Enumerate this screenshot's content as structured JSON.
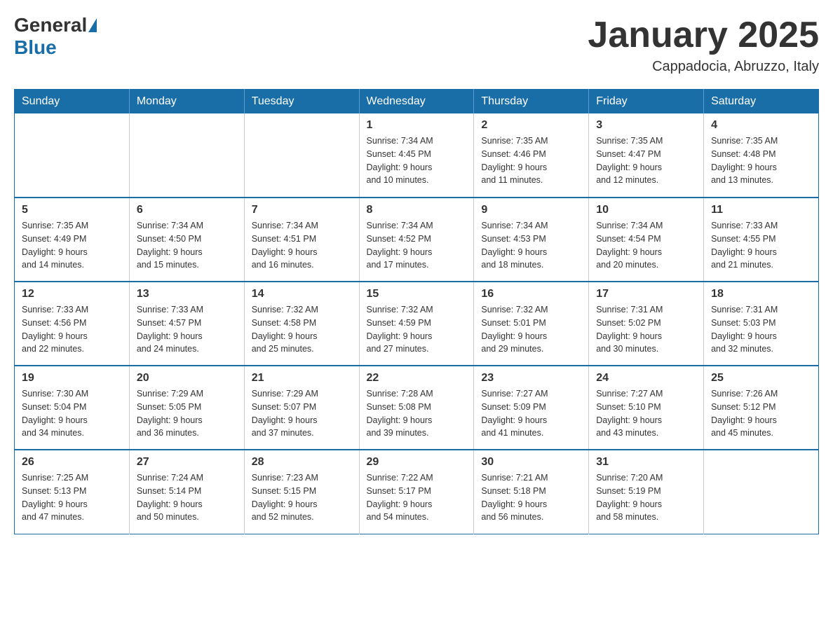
{
  "header": {
    "logo_general": "General",
    "logo_blue": "Blue",
    "title": "January 2025",
    "location": "Cappadocia, Abruzzo, Italy"
  },
  "days_of_week": [
    "Sunday",
    "Monday",
    "Tuesday",
    "Wednesday",
    "Thursday",
    "Friday",
    "Saturday"
  ],
  "weeks": [
    [
      {
        "day": "",
        "info": ""
      },
      {
        "day": "",
        "info": ""
      },
      {
        "day": "",
        "info": ""
      },
      {
        "day": "1",
        "info": "Sunrise: 7:34 AM\nSunset: 4:45 PM\nDaylight: 9 hours\nand 10 minutes."
      },
      {
        "day": "2",
        "info": "Sunrise: 7:35 AM\nSunset: 4:46 PM\nDaylight: 9 hours\nand 11 minutes."
      },
      {
        "day": "3",
        "info": "Sunrise: 7:35 AM\nSunset: 4:47 PM\nDaylight: 9 hours\nand 12 minutes."
      },
      {
        "day": "4",
        "info": "Sunrise: 7:35 AM\nSunset: 4:48 PM\nDaylight: 9 hours\nand 13 minutes."
      }
    ],
    [
      {
        "day": "5",
        "info": "Sunrise: 7:35 AM\nSunset: 4:49 PM\nDaylight: 9 hours\nand 14 minutes."
      },
      {
        "day": "6",
        "info": "Sunrise: 7:34 AM\nSunset: 4:50 PM\nDaylight: 9 hours\nand 15 minutes."
      },
      {
        "day": "7",
        "info": "Sunrise: 7:34 AM\nSunset: 4:51 PM\nDaylight: 9 hours\nand 16 minutes."
      },
      {
        "day": "8",
        "info": "Sunrise: 7:34 AM\nSunset: 4:52 PM\nDaylight: 9 hours\nand 17 minutes."
      },
      {
        "day": "9",
        "info": "Sunrise: 7:34 AM\nSunset: 4:53 PM\nDaylight: 9 hours\nand 18 minutes."
      },
      {
        "day": "10",
        "info": "Sunrise: 7:34 AM\nSunset: 4:54 PM\nDaylight: 9 hours\nand 20 minutes."
      },
      {
        "day": "11",
        "info": "Sunrise: 7:33 AM\nSunset: 4:55 PM\nDaylight: 9 hours\nand 21 minutes."
      }
    ],
    [
      {
        "day": "12",
        "info": "Sunrise: 7:33 AM\nSunset: 4:56 PM\nDaylight: 9 hours\nand 22 minutes."
      },
      {
        "day": "13",
        "info": "Sunrise: 7:33 AM\nSunset: 4:57 PM\nDaylight: 9 hours\nand 24 minutes."
      },
      {
        "day": "14",
        "info": "Sunrise: 7:32 AM\nSunset: 4:58 PM\nDaylight: 9 hours\nand 25 minutes."
      },
      {
        "day": "15",
        "info": "Sunrise: 7:32 AM\nSunset: 4:59 PM\nDaylight: 9 hours\nand 27 minutes."
      },
      {
        "day": "16",
        "info": "Sunrise: 7:32 AM\nSunset: 5:01 PM\nDaylight: 9 hours\nand 29 minutes."
      },
      {
        "day": "17",
        "info": "Sunrise: 7:31 AM\nSunset: 5:02 PM\nDaylight: 9 hours\nand 30 minutes."
      },
      {
        "day": "18",
        "info": "Sunrise: 7:31 AM\nSunset: 5:03 PM\nDaylight: 9 hours\nand 32 minutes."
      }
    ],
    [
      {
        "day": "19",
        "info": "Sunrise: 7:30 AM\nSunset: 5:04 PM\nDaylight: 9 hours\nand 34 minutes."
      },
      {
        "day": "20",
        "info": "Sunrise: 7:29 AM\nSunset: 5:05 PM\nDaylight: 9 hours\nand 36 minutes."
      },
      {
        "day": "21",
        "info": "Sunrise: 7:29 AM\nSunset: 5:07 PM\nDaylight: 9 hours\nand 37 minutes."
      },
      {
        "day": "22",
        "info": "Sunrise: 7:28 AM\nSunset: 5:08 PM\nDaylight: 9 hours\nand 39 minutes."
      },
      {
        "day": "23",
        "info": "Sunrise: 7:27 AM\nSunset: 5:09 PM\nDaylight: 9 hours\nand 41 minutes."
      },
      {
        "day": "24",
        "info": "Sunrise: 7:27 AM\nSunset: 5:10 PM\nDaylight: 9 hours\nand 43 minutes."
      },
      {
        "day": "25",
        "info": "Sunrise: 7:26 AM\nSunset: 5:12 PM\nDaylight: 9 hours\nand 45 minutes."
      }
    ],
    [
      {
        "day": "26",
        "info": "Sunrise: 7:25 AM\nSunset: 5:13 PM\nDaylight: 9 hours\nand 47 minutes."
      },
      {
        "day": "27",
        "info": "Sunrise: 7:24 AM\nSunset: 5:14 PM\nDaylight: 9 hours\nand 50 minutes."
      },
      {
        "day": "28",
        "info": "Sunrise: 7:23 AM\nSunset: 5:15 PM\nDaylight: 9 hours\nand 52 minutes."
      },
      {
        "day": "29",
        "info": "Sunrise: 7:22 AM\nSunset: 5:17 PM\nDaylight: 9 hours\nand 54 minutes."
      },
      {
        "day": "30",
        "info": "Sunrise: 7:21 AM\nSunset: 5:18 PM\nDaylight: 9 hours\nand 56 minutes."
      },
      {
        "day": "31",
        "info": "Sunrise: 7:20 AM\nSunset: 5:19 PM\nDaylight: 9 hours\nand 58 minutes."
      },
      {
        "day": "",
        "info": ""
      }
    ]
  ]
}
